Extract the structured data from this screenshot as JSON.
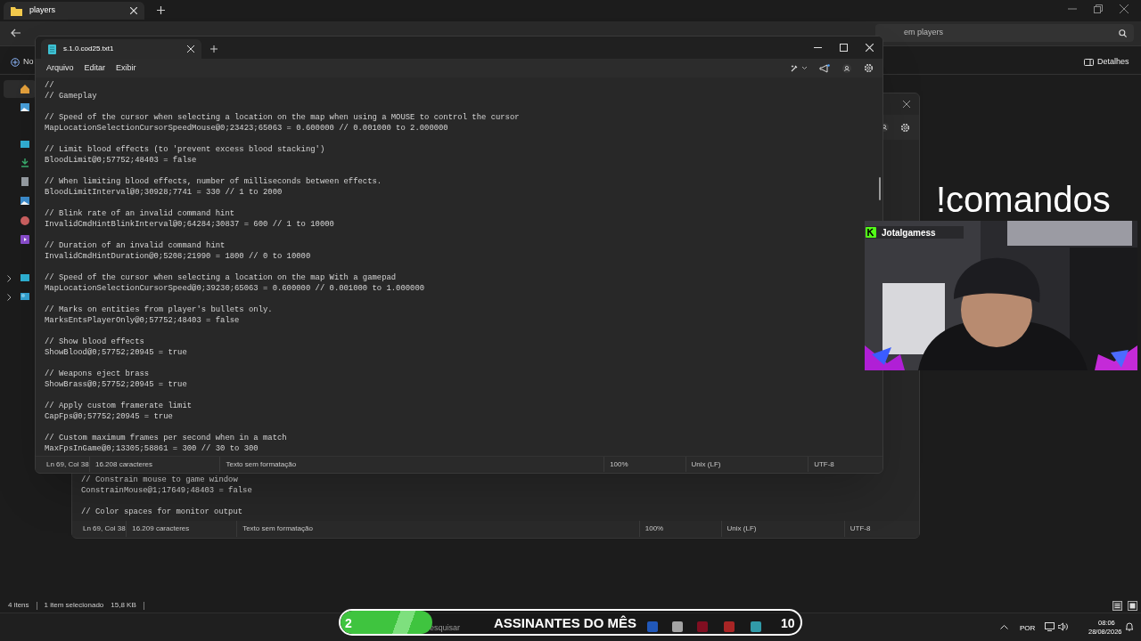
{
  "explorer": {
    "tab_title": "players",
    "search_placeholder": "em players",
    "new_button": "No",
    "details_button": "Detalhes",
    "status": [
      "4 itens",
      "1 item selecionado",
      "15,8 KB"
    ]
  },
  "back_notepad": {
    "blocks": [
      [
        "// Constrain mouse to game window",
        "ConstrainMouse@1;17649;48403 = false"
      ],
      [
        "// Color spaces for monitor output"
      ]
    ],
    "status": {
      "position": "Ln 69, Col 38",
      "characters": "16.209 caracteres",
      "format": "Texto sem formatação",
      "zoom": "100%",
      "line_ending": "Unix (LF)",
      "encoding": "UTF-8"
    }
  },
  "notepad": {
    "tab_title": "s.1.0.cod25.txt1",
    "menu": [
      "Arquivo",
      "Editar",
      "Exibir"
    ],
    "blocks": [
      [
        "//",
        "// Gameplay"
      ],
      [
        "// Speed of the cursor when selecting a location on the map when using a MOUSE to control the cursor",
        "MapLocationSelectionCursorSpeedMouse@0;23423;65063 = 0.600000 // 0.001000 to 2.000000"
      ],
      [
        "// Limit blood effects (to 'prevent excess blood stacking')",
        "BloodLimit@0;57752;48403 = false"
      ],
      [
        "// When limiting blood effects, number of milliseconds between effects.",
        "BloodLimitInterval@0;30928;7741 = 330 // 1 to 2000"
      ],
      [
        "// Blink rate of an invalid command hint",
        "InvalidCmdHintBlinkInterval@0;64284;30837 = 600 // 1 to 10000"
      ],
      [
        "// Duration of an invalid command hint",
        "InvalidCmdHintDuration@0;5208;21990 = 1800 // 0 to 10000"
      ],
      [
        "// Speed of the cursor when selecting a location on the map With a gamepad",
        "MapLocationSelectionCursorSpeed@0;39230;65063 = 0.600000 // 0.001000 to 1.000000"
      ],
      [
        "// Marks on entities from player's bullets only.",
        "MarksEntsPlayerOnly@0;57752;48403 = false"
      ],
      [
        "// Show blood effects",
        "ShowBlood@0;57752;20945 = true"
      ],
      [
        "// Weapons eject brass",
        "ShowBrass@0;57752;20945 = true"
      ],
      [
        "// Apply custom framerate limit",
        "CapFps@0;57752;20945 = true"
      ],
      [
        "// Custom maximum frames per second when in a match",
        "MaxFpsInGame@0;13305;58861 = 300 // 30 to 300"
      ]
    ],
    "status": {
      "position": "Ln 69, Col 38",
      "characters": "16.208 caracteres",
      "format": "Texto sem formatação",
      "zoom": "100%",
      "line_ending": "Unix (LF)",
      "encoding": "UTF-8"
    }
  },
  "overlay": {
    "command_text": "!comandos",
    "webcam_label": "Jotalgamess",
    "goal": {
      "current": "2",
      "title": "ASSINANTES DO MÊS",
      "target": "10",
      "level": 0.2
    }
  },
  "taskbar": {
    "search_placeholder": "esquisar",
    "language": "POR",
    "time": "08:06",
    "date": "28/08/2026"
  }
}
